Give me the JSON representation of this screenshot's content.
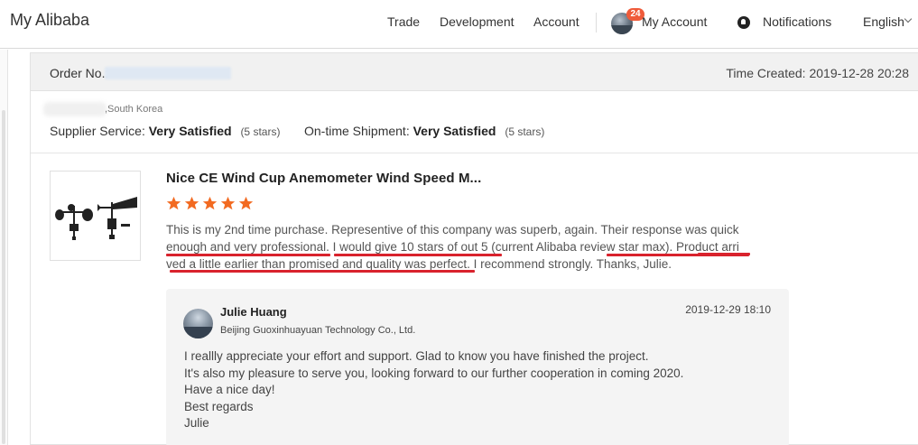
{
  "nav": {
    "brand": "My Alibaba",
    "links": [
      "Trade",
      "Development",
      "Account"
    ],
    "message_count": "24",
    "my_account": "My Account",
    "notifications": "Notifications",
    "language": "English",
    "icons": [
      "avatar",
      "bell-icon",
      "chevron-down-icon"
    ]
  },
  "order": {
    "order_no_label": "Order No.:",
    "time_created": "Time Created: 2019-12-28 20:28",
    "buyer_country": ",South Korea",
    "supplier_service_label": "Supplier Service:",
    "supplier_service_value": "Very Satisfied",
    "supplier_service_stars": "(5 stars)",
    "shipment_label": "On-time Shipment:",
    "shipment_value": "Very Satisfied",
    "shipment_stars": "(5 stars)"
  },
  "product": {
    "title": "Nice CE Wind Cup Anemometer Wind Speed M...",
    "rating": 5,
    "review_line1": "This is my 2nd time purchase. Representive of this company was superb, again. Their response was quick",
    "review_line2": "enough and very professional. I would give 10 stars of out 5 (current Alibaba review star max). Product arri",
    "review_line3": "ved a little earlier than promised and quality was perfect. I recommend strongly. Thanks, Julie."
  },
  "reply": {
    "name": "Julie Huang",
    "company": "Beijing Guoxinhuayuan Technology Co., Ltd.",
    "time": "2019-12-29 18:10",
    "lines": [
      "I reallly appreciate your effort and support. Glad to know you have finished the project.",
      "It's also my pleasure to serve you, looking forward to our further cooperation in coming 2020.",
      "Have a nice day!",
      "Best regards",
      "Julie"
    ]
  },
  "colors": {
    "star": "#f26a21",
    "underline": "#d9232d",
    "badge": "#ef5b3a",
    "header_bg": "#f1f1f1",
    "reply_bg": "#f4f4f4"
  }
}
